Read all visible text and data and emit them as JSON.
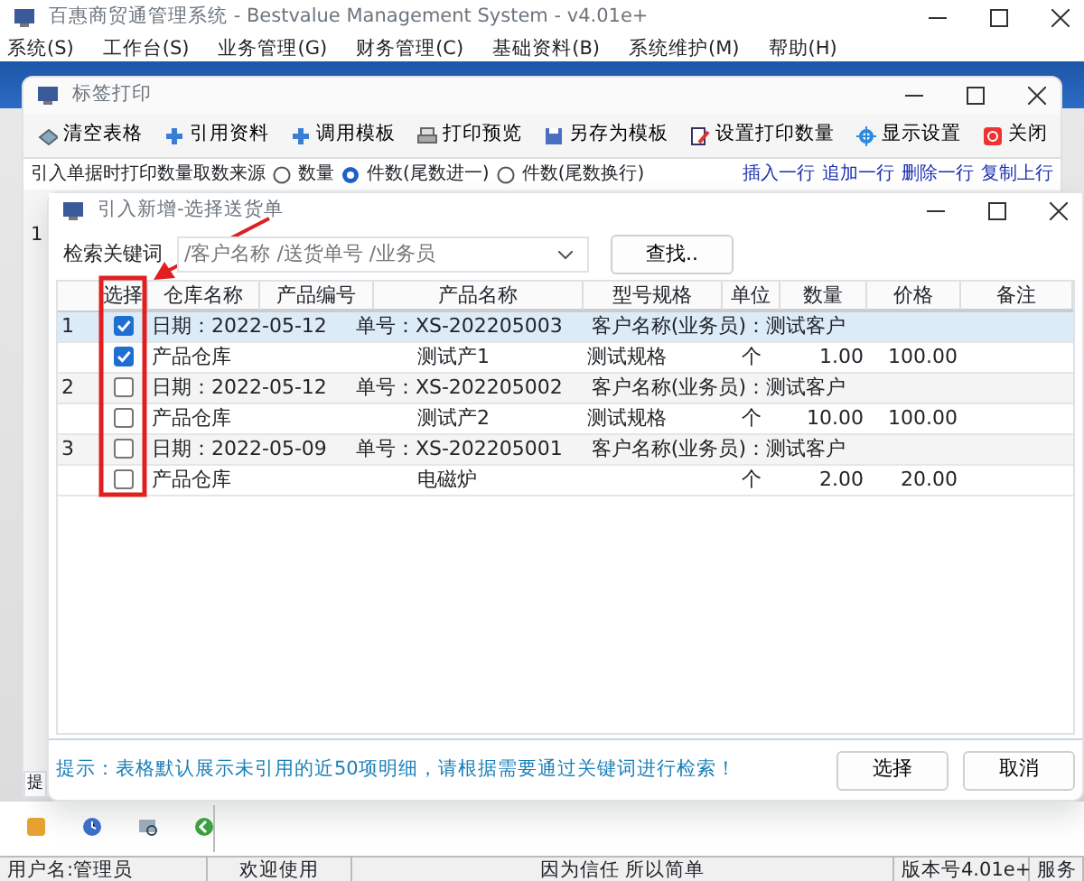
{
  "main_window": {
    "title": "百惠商贸通管理系统 - Bestvalue Management System - v4.01e+",
    "menu": [
      "系统(S)",
      "工作台(S)",
      "业务管理(G)",
      "财务管理(C)",
      "基础资料(B)",
      "系统维护(M)",
      "帮助(H)"
    ]
  },
  "label_window": {
    "title": "标签打印",
    "toolbar": [
      "清空表格",
      "引用资料",
      "调用模板",
      "打印预览",
      "另存为模板",
      "设置打印数量",
      "显示设置",
      "关闭"
    ],
    "source_label": "引入单据时打印数量取数来源",
    "source_options": [
      {
        "label": "数量",
        "selected": false
      },
      {
        "label": "件数(尾数进一)",
        "selected": true
      },
      {
        "label": "件数(尾数换行)",
        "selected": false
      }
    ],
    "row_actions": [
      "插入一行",
      "追加一行",
      "删除一行",
      "复制上行"
    ],
    "behind_row_number": "1",
    "behind_tab": "提"
  },
  "dialog": {
    "title": "引入新增-选择送货单",
    "search_label": "检索关键词",
    "search": {
      "placeholder": "/客户名称 /送货单号 /业务员"
    },
    "find_button": "查找..",
    "columns": [
      "选择",
      "仓库名称",
      "产品编号",
      "产品名称",
      "型号规格",
      "单位",
      "数量",
      "价格",
      "备注"
    ],
    "rows": [
      {
        "kind": "order",
        "number": "1",
        "checked": true,
        "selected": true,
        "date": "日期：2022-05-12",
        "order_no": "单号：XS-202205003",
        "customer": "客户名称(业务员)：测试客户"
      },
      {
        "kind": "item",
        "checked": true,
        "selected": false,
        "warehouse": "产品仓库",
        "product": "测试产1",
        "spec": "测试规格",
        "unit": "个",
        "qty": "1.00",
        "price": "100.00"
      },
      {
        "kind": "order",
        "number": "2",
        "checked": false,
        "selected": false,
        "date": "日期：2022-05-12",
        "order_no": "单号：XS-202205002",
        "customer": "客户名称(业务员)：测试客户"
      },
      {
        "kind": "item",
        "checked": false,
        "selected": false,
        "warehouse": "产品仓库",
        "product": "测试产2",
        "spec": "测试规格",
        "unit": "个",
        "qty": "10.00",
        "price": "100.00"
      },
      {
        "kind": "order",
        "number": "3",
        "checked": false,
        "selected": false,
        "date": "日期：2022-05-09",
        "order_no": "单号：XS-202205001",
        "customer": "客户名称(业务员)：测试客户"
      },
      {
        "kind": "item",
        "checked": false,
        "selected": false,
        "warehouse": "产品仓库",
        "product": "电磁炉",
        "unit": "个",
        "qty": "2.00",
        "price": "20.00"
      }
    ],
    "hint": "提示：表格默认展示未引用的近50项明细，请根据需要通过关键词进行检索！",
    "buttons": [
      "选择",
      "取消"
    ]
  },
  "status_bar": [
    "用户名:管理员",
    "欢迎使用",
    "因为信任 所以简单",
    "版本号4.01e+",
    "服务"
  ]
}
